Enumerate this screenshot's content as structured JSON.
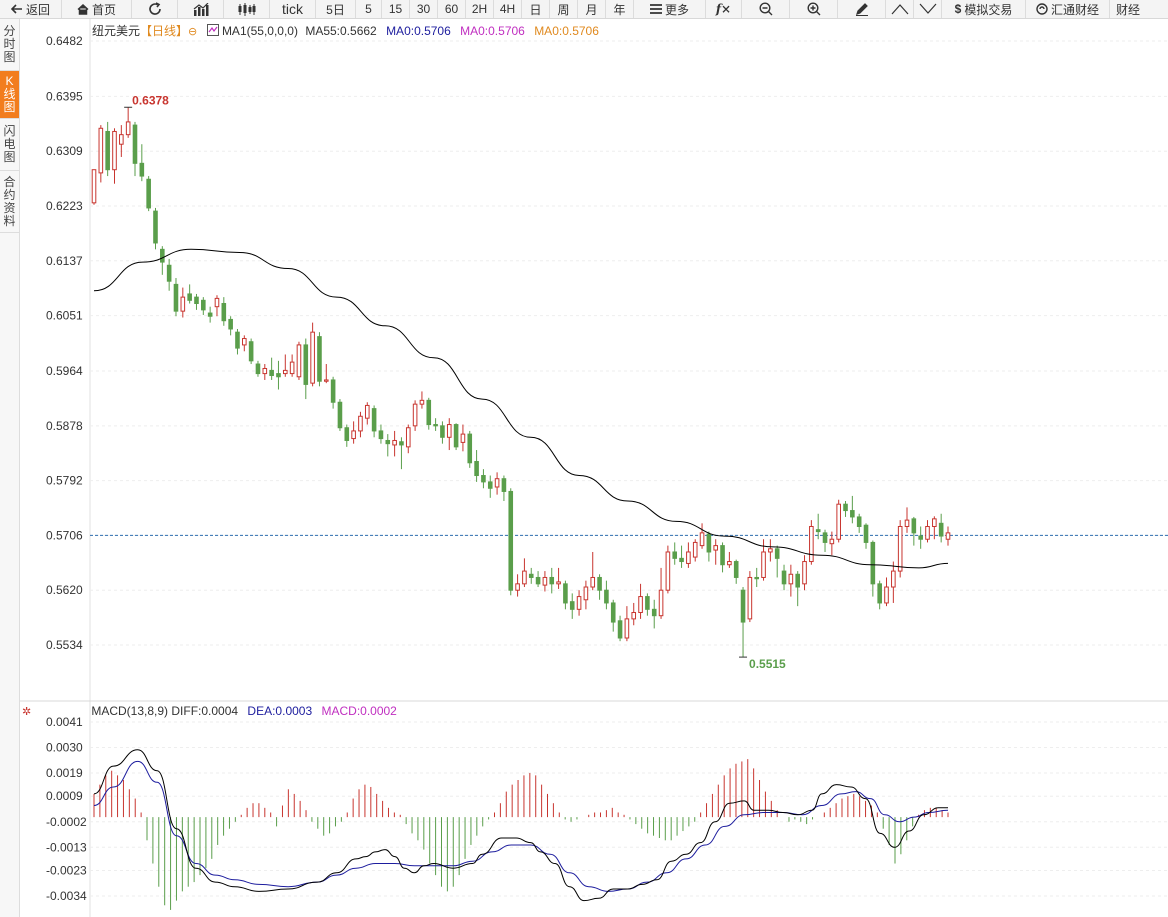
{
  "toolbar": {
    "back": "返回",
    "home": "首页",
    "tick": "tick",
    "d5": "5日",
    "p5": "5",
    "p15": "15",
    "p30": "30",
    "p60": "60",
    "h2": "2H",
    "h4": "4H",
    "day": "日",
    "week": "周",
    "month": "月",
    "year": "年",
    "more": "更多",
    "sim_trade": "模拟交易",
    "huitong": "汇通财经",
    "caijing": "财经"
  },
  "sidebar": {
    "tabs": [
      {
        "label": "分时图",
        "active": false
      },
      {
        "label": "K线图",
        "active": true
      },
      {
        "label": "闪电图",
        "active": false
      },
      {
        "label": "合约资料",
        "active": false
      }
    ]
  },
  "header": {
    "symbol": "纽元美元",
    "period": "【日线】",
    "ma_label": "MA1(55,0,0,0)",
    "ma55": "MA55:0.5662",
    "ma0_a": "MA0:0.5706",
    "ma0_b": "MA0:0.5706",
    "ma0_c": "MA0:0.5706"
  },
  "macd_header": {
    "label": "MACD(13,8,9)",
    "diff": "DIFF:0.0004",
    "dea": "DEA:0.0003",
    "macd": "MACD:0.0002"
  },
  "colors": {
    "up": "#c8352f",
    "down": "#5a9e4b",
    "ma55": "#000000",
    "diff": "#000000",
    "dea": "#1d1d9e",
    "current_line": "#2f6fb0",
    "macd_label": "#c02fc0",
    "dea_label": "#1d1d9e",
    "ma0_a": "#1d1d9e",
    "ma0_b": "#c02fc0",
    "ma0_c": "#e08a20",
    "active_tab": "#f27d1e"
  },
  "chart_data": {
    "type": "candlestick",
    "price_axis_ticks": [
      "0.6482",
      "0.6395",
      "0.6309",
      "0.6223",
      "0.6137",
      "0.6051",
      "0.5964",
      "0.5878",
      "0.5792",
      "0.5706",
      "0.5620",
      "0.5534"
    ],
    "price_range": [
      0.5452,
      0.6506
    ],
    "current_price": 0.5706,
    "annotations": {
      "high": "0.6378",
      "low": "0.5515"
    },
    "macd_axis_ticks": [
      "0.0041",
      "0.0030",
      "0.0019",
      "0.0009",
      "-0.0002",
      "-0.0013",
      "-0.0023",
      "-0.0034"
    ],
    "macd_range": [
      -0.0043,
      0.0045
    ],
    "ohlc": [
      [
        0.6228,
        0.628,
        0.626,
        0.6225
      ],
      [
        0.6275,
        0.6345,
        0.635,
        0.626
      ],
      [
        0.634,
        0.628,
        0.6355,
        0.627
      ],
      [
        0.628,
        0.634,
        0.6345,
        0.6258
      ],
      [
        0.632,
        0.6335,
        0.635,
        0.63
      ],
      [
        0.6335,
        0.6355,
        0.6378,
        0.633
      ],
      [
        0.635,
        0.629,
        0.6355,
        0.627
      ],
      [
        0.629,
        0.627,
        0.632,
        0.6262
      ],
      [
        0.6265,
        0.622,
        0.627,
        0.6215
      ],
      [
        0.6215,
        0.6165,
        0.622,
        0.6155
      ],
      [
        0.6155,
        0.6135,
        0.616,
        0.6115
      ],
      [
        0.613,
        0.6105,
        0.614,
        0.609
      ],
      [
        0.61,
        0.6058,
        0.611,
        0.605
      ],
      [
        0.6058,
        0.608,
        0.6095,
        0.6048
      ],
      [
        0.6085,
        0.6075,
        0.61,
        0.607
      ],
      [
        0.608,
        0.607,
        0.6085,
        0.606
      ],
      [
        0.6075,
        0.606,
        0.608,
        0.6052
      ],
      [
        0.6055,
        0.605,
        0.6065,
        0.604
      ],
      [
        0.6065,
        0.6078,
        0.6083,
        0.605
      ],
      [
        0.607,
        0.6043,
        0.608,
        0.6035
      ],
      [
        0.6045,
        0.603,
        0.605,
        0.602
      ],
      [
        0.6025,
        0.6,
        0.603,
        0.599
      ],
      [
        0.6005,
        0.6015,
        0.602,
        0.5995
      ],
      [
        0.601,
        0.598,
        0.6015,
        0.5975
      ],
      [
        0.5975,
        0.596,
        0.598,
        0.5955
      ],
      [
        0.596,
        0.5968,
        0.5975,
        0.595
      ],
      [
        0.5965,
        0.5957,
        0.5985,
        0.595
      ],
      [
        0.596,
        0.5955,
        0.598,
        0.5935
      ],
      [
        0.596,
        0.5965,
        0.599,
        0.5955
      ],
      [
        0.596,
        0.5978,
        0.599,
        0.5955
      ],
      [
        0.5955,
        0.6005,
        0.601,
        0.595
      ],
      [
        0.6005,
        0.5943,
        0.6015,
        0.592
      ],
      [
        0.5945,
        0.6025,
        0.604,
        0.594
      ],
      [
        0.6018,
        0.5948,
        0.6025,
        0.594
      ],
      [
        0.5948,
        0.595,
        0.5975,
        0.5945
      ],
      [
        0.595,
        0.5915,
        0.5955,
        0.5905
      ],
      [
        0.5915,
        0.5875,
        0.592,
        0.587
      ],
      [
        0.5875,
        0.5855,
        0.588,
        0.5845
      ],
      [
        0.5858,
        0.587,
        0.5885,
        0.585
      ],
      [
        0.587,
        0.5893,
        0.59,
        0.586
      ],
      [
        0.589,
        0.591,
        0.5915,
        0.588
      ],
      [
        0.5905,
        0.587,
        0.591,
        0.586
      ],
      [
        0.587,
        0.5858,
        0.588,
        0.585
      ],
      [
        0.5855,
        0.585,
        0.5865,
        0.583
      ],
      [
        0.5848,
        0.5855,
        0.587,
        0.583
      ],
      [
        0.5853,
        0.5848,
        0.586,
        0.581
      ],
      [
        0.5845,
        0.5875,
        0.588,
        0.5835
      ],
      [
        0.5878,
        0.5912,
        0.5918,
        0.587
      ],
      [
        0.5912,
        0.5918,
        0.5932,
        0.5905
      ],
      [
        0.5918,
        0.588,
        0.5922,
        0.5872
      ],
      [
        0.588,
        0.5878,
        0.589,
        0.587
      ],
      [
        0.5878,
        0.586,
        0.5885,
        0.585
      ],
      [
        0.586,
        0.588,
        0.589,
        0.584
      ],
      [
        0.588,
        0.5845,
        0.5882,
        0.584
      ],
      [
        0.5852,
        0.5865,
        0.588,
        0.5838
      ],
      [
        0.5865,
        0.582,
        0.587,
        0.5812
      ],
      [
        0.5822,
        0.58,
        0.584,
        0.579
      ],
      [
        0.58,
        0.579,
        0.581,
        0.578
      ],
      [
        0.579,
        0.578,
        0.58,
        0.5765
      ],
      [
        0.5782,
        0.5795,
        0.5805,
        0.577
      ],
      [
        0.5795,
        0.5775,
        0.58,
        0.576
      ],
      [
        0.5775,
        0.562,
        0.578,
        0.5612
      ],
      [
        0.562,
        0.563,
        0.5645,
        0.561
      ],
      [
        0.563,
        0.565,
        0.567,
        0.5625
      ],
      [
        0.5645,
        0.564,
        0.5655,
        0.563
      ],
      [
        0.564,
        0.563,
        0.565,
        0.5625
      ],
      [
        0.5628,
        0.564,
        0.565,
        0.5618
      ],
      [
        0.564,
        0.563,
        0.5655,
        0.5615
      ],
      [
        0.563,
        0.5633,
        0.5655,
        0.5622
      ],
      [
        0.563,
        0.56,
        0.5635,
        0.559
      ],
      [
        0.5602,
        0.559,
        0.5615,
        0.5575
      ],
      [
        0.559,
        0.561,
        0.562,
        0.558
      ],
      [
        0.5605,
        0.5625,
        0.5635,
        0.559
      ],
      [
        0.5625,
        0.564,
        0.568,
        0.562
      ],
      [
        0.564,
        0.562,
        0.5645,
        0.5605
      ],
      [
        0.562,
        0.56,
        0.5635,
        0.559
      ],
      [
        0.56,
        0.557,
        0.5605,
        0.5555
      ],
      [
        0.5572,
        0.5545,
        0.558,
        0.554
      ],
      [
        0.5545,
        0.5575,
        0.5595,
        0.554
      ],
      [
        0.5575,
        0.5585,
        0.56,
        0.5565
      ],
      [
        0.5585,
        0.561,
        0.563,
        0.5575
      ],
      [
        0.561,
        0.559,
        0.5615,
        0.558
      ],
      [
        0.559,
        0.558,
        0.5605,
        0.556
      ],
      [
        0.558,
        0.562,
        0.5655,
        0.5575
      ],
      [
        0.562,
        0.568,
        0.569,
        0.5615
      ],
      [
        0.568,
        0.567,
        0.5695,
        0.566
      ],
      [
        0.567,
        0.5665,
        0.569,
        0.5655
      ],
      [
        0.5662,
        0.568,
        0.5695,
        0.5655
      ],
      [
        0.5672,
        0.5695,
        0.57,
        0.5665
      ],
      [
        0.569,
        0.571,
        0.5725,
        0.5685
      ],
      [
        0.5708,
        0.568,
        0.5712,
        0.5665
      ],
      [
        0.5683,
        0.569,
        0.57,
        0.566
      ],
      [
        0.569,
        0.566,
        0.5695,
        0.5648
      ],
      [
        0.566,
        0.5665,
        0.568,
        0.5655
      ],
      [
        0.5665,
        0.564,
        0.5668,
        0.563
      ],
      [
        0.562,
        0.557,
        0.5625,
        0.5515
      ],
      [
        0.5575,
        0.564,
        0.565,
        0.557
      ],
      [
        0.564,
        0.5638,
        0.5655,
        0.5625
      ],
      [
        0.564,
        0.568,
        0.57,
        0.5635
      ],
      [
        0.568,
        0.5685,
        0.57,
        0.5665
      ],
      [
        0.5685,
        0.567,
        0.569,
        0.564
      ],
      [
        0.565,
        0.563,
        0.566,
        0.562
      ],
      [
        0.563,
        0.5645,
        0.566,
        0.561
      ],
      [
        0.5645,
        0.5625,
        0.565,
        0.5595
      ],
      [
        0.563,
        0.5665,
        0.5675,
        0.562
      ],
      [
        0.5665,
        0.572,
        0.573,
        0.566
      ],
      [
        0.5715,
        0.5712,
        0.574,
        0.57
      ],
      [
        0.571,
        0.5695,
        0.5715,
        0.568
      ],
      [
        0.5693,
        0.57,
        0.5712,
        0.5675
      ],
      [
        0.57,
        0.5755,
        0.5762,
        0.5695
      ],
      [
        0.5755,
        0.5745,
        0.576,
        0.5735
      ],
      [
        0.5745,
        0.5735,
        0.5768,
        0.5725
      ],
      [
        0.5735,
        0.572,
        0.574,
        0.571
      ],
      [
        0.5722,
        0.5695,
        0.5725,
        0.5685
      ],
      [
        0.5695,
        0.563,
        0.5698,
        0.561
      ],
      [
        0.563,
        0.56,
        0.5635,
        0.559
      ],
      [
        0.56,
        0.5625,
        0.564,
        0.5595
      ],
      [
        0.5625,
        0.565,
        0.5665,
        0.56
      ],
      [
        0.565,
        0.572,
        0.573,
        0.564
      ],
      [
        0.572,
        0.573,
        0.575,
        0.571
      ],
      [
        0.5732,
        0.571,
        0.5735,
        0.569
      ],
      [
        0.5705,
        0.57,
        0.572,
        0.5685
      ],
      [
        0.57,
        0.572,
        0.573,
        0.5695
      ],
      [
        0.572,
        0.5732,
        0.5736,
        0.57
      ],
      [
        0.5725,
        0.5705,
        0.574,
        0.5695
      ],
      [
        0.57,
        0.571,
        0.572,
        0.569
      ]
    ],
    "ma55": [
      [
        0,
        0.609
      ],
      [
        10,
        0.6135
      ],
      [
        20,
        0.6155
      ],
      [
        30,
        0.615
      ],
      [
        40,
        0.6125
      ],
      [
        50,
        0.608
      ],
      [
        60,
        0.6035
      ],
      [
        70,
        0.5985
      ],
      [
        80,
        0.592
      ],
      [
        90,
        0.586
      ],
      [
        100,
        0.58
      ],
      [
        110,
        0.576
      ],
      [
        120,
        0.5728
      ],
      [
        130,
        0.5705
      ],
      [
        140,
        0.5688
      ],
      [
        150,
        0.5675
      ],
      [
        160,
        0.566
      ],
      [
        170,
        0.5655
      ],
      [
        176,
        0.5662
      ]
    ],
    "macd_diff": [
      [
        0,
        0.001
      ],
      [
        4,
        0.0022
      ],
      [
        9,
        0.0029
      ],
      [
        13,
        0.002
      ],
      [
        17,
        -0.0005
      ],
      [
        21,
        -0.0022
      ],
      [
        25,
        -0.0028
      ],
      [
        29,
        -0.003
      ],
      [
        34,
        -0.0032
      ],
      [
        40,
        -0.0031
      ],
      [
        46,
        -0.0028
      ],
      [
        50,
        -0.0024
      ],
      [
        54,
        -0.0018
      ],
      [
        56,
        -0.0017
      ],
      [
        58,
        -0.0015
      ],
      [
        60,
        -0.0014
      ],
      [
        62,
        -0.0017
      ],
      [
        64,
        -0.0022
      ],
      [
        66,
        -0.0024
      ],
      [
        68,
        -0.0021
      ],
      [
        70,
        -0.002
      ],
      [
        74,
        -0.0022
      ],
      [
        78,
        -0.002
      ],
      [
        80,
        -0.0016
      ],
      [
        84,
        -0.0009
      ],
      [
        87,
        -0.0009
      ],
      [
        90,
        -0.0011
      ],
      [
        92,
        -0.0015
      ],
      [
        95,
        -0.002
      ],
      [
        98,
        -0.003
      ],
      [
        101,
        -0.0036
      ],
      [
        104,
        -0.0035
      ],
      [
        107,
        -0.0031
      ],
      [
        110,
        -0.0031
      ],
      [
        113,
        -0.0029
      ],
      [
        116,
        -0.0027
      ],
      [
        119,
        -0.0019
      ],
      [
        122,
        -0.0016
      ],
      [
        125,
        -0.0011
      ],
      [
        128,
        -0.0002
      ],
      [
        131,
        0.0006
      ],
      [
        134,
        0.0007
      ],
      [
        136,
        0.0003
      ],
      [
        139,
        0.0003
      ],
      [
        142,
        0.0002
      ],
      [
        145,
        0.0001
      ],
      [
        148,
        0.0003
      ],
      [
        150,
        0.001
      ],
      [
        153,
        0.0014
      ],
      [
        156,
        0.0013
      ],
      [
        159,
        0.0008
      ],
      [
        162,
        -0.0007
      ],
      [
        165,
        -0.0013
      ],
      [
        168,
        -0.0006
      ],
      [
        171,
        0.0001
      ],
      [
        174,
        0.0004
      ],
      [
        176,
        0.0004
      ]
    ],
    "macd_dea": [
      [
        0,
        0.0005
      ],
      [
        4,
        0.0013
      ],
      [
        9,
        0.0024
      ],
      [
        13,
        0.0015
      ],
      [
        17,
        -0.0008
      ],
      [
        21,
        -0.002
      ],
      [
        25,
        -0.0025
      ],
      [
        29,
        -0.0027
      ],
      [
        34,
        -0.0029
      ],
      [
        40,
        -0.003
      ],
      [
        46,
        -0.0028
      ],
      [
        50,
        -0.0025
      ],
      [
        54,
        -0.0022
      ],
      [
        58,
        -0.002
      ],
      [
        62,
        -0.002
      ],
      [
        66,
        -0.0021
      ],
      [
        70,
        -0.0021
      ],
      [
        74,
        -0.0021
      ],
      [
        78,
        -0.0019
      ],
      [
        82,
        -0.0015
      ],
      [
        86,
        -0.0012
      ],
      [
        90,
        -0.0012
      ],
      [
        94,
        -0.0016
      ],
      [
        98,
        -0.0024
      ],
      [
        102,
        -0.003
      ],
      [
        106,
        -0.0032
      ],
      [
        110,
        -0.0031
      ],
      [
        114,
        -0.0028
      ],
      [
        118,
        -0.0024
      ],
      [
        122,
        -0.0018
      ],
      [
        126,
        -0.0012
      ],
      [
        130,
        -0.0004
      ],
      [
        134,
        0.0001
      ],
      [
        138,
        0.0002
      ],
      [
        142,
        0.0002
      ],
      [
        146,
        0.0001
      ],
      [
        150,
        0.0005
      ],
      [
        154,
        0.001
      ],
      [
        157,
        0.0011
      ],
      [
        160,
        0.0008
      ],
      [
        163,
        0.0001
      ],
      [
        166,
        -0.0002
      ],
      [
        169,
        0.0
      ],
      [
        172,
        0.0002
      ],
      [
        176,
        0.0003
      ]
    ],
    "macd_hist": [
      0.001,
      0.0014,
      0.0018,
      0.002,
      0.0018,
      0.0016,
      0.0012,
      0.0008,
      0.0002,
      -0.001,
      -0.002,
      -0.003,
      -0.0038,
      -0.004,
      -0.0036,
      -0.0032,
      -0.003,
      -0.0028,
      -0.0025,
      -0.0022,
      -0.0018,
      -0.0012,
      -0.0008,
      -0.0005,
      -0.0002,
      0.0001,
      0.0004,
      0.0006,
      0.0006,
      0.0004,
      0.0002,
      -0.0004,
      0.0005,
      0.0012,
      0.001,
      0.0007,
      0.0003,
      -0.0002,
      -0.0005,
      -0.0008,
      -0.0007,
      -0.0004,
      -0.0002,
      0.0002,
      0.0008,
      0.0012,
      0.0014,
      0.0013,
      0.001,
      0.0007,
      0.0004,
      0.0002,
      0.0001,
      -0.0003,
      -0.0007,
      -0.001,
      -0.0014,
      -0.002,
      -0.0025,
      -0.003,
      -0.0032,
      -0.003,
      -0.0025,
      -0.0018,
      -0.0012,
      -0.0008,
      -0.0004,
      -0.0001,
      0.0002,
      0.0006,
      0.0011,
      0.0014,
      0.0016,
      0.0018,
      0.0019,
      0.0018,
      0.0014,
      0.001,
      0.0006,
      0.0002,
      -0.0001,
      -0.0002,
      -0.0001,
      0.0,
      0.0001,
      0.0002,
      0.0002,
      0.0003,
      0.0004,
      0.0002,
      0.0001,
      -0.0001,
      -0.0003,
      -0.0005,
      -0.0007,
      -0.0008,
      -0.0009,
      -0.001,
      -0.001,
      -0.0008,
      -0.0006,
      -0.0004,
      -0.0002,
      0.0002,
      0.0006,
      0.001,
      0.0014,
      0.0018,
      0.0021,
      0.0023,
      0.0024,
      0.0025,
      0.0021,
      0.0016,
      0.0011,
      0.0007,
      0.0003,
      0.0,
      -0.0002,
      -0.0001,
      -0.0002,
      -0.0003,
      -0.0001,
      0.0,
      0.0002,
      0.0004,
      0.0006,
      0.0008,
      0.0009,
      0.001,
      0.0009,
      0.0007,
      0.0005,
      0.0002,
      -0.0005,
      -0.0012,
      -0.002,
      -0.0016,
      -0.001,
      -0.0004,
      0.0001,
      0.0003,
      0.0004,
      0.0004,
      0.0003,
      0.0002
    ]
  }
}
